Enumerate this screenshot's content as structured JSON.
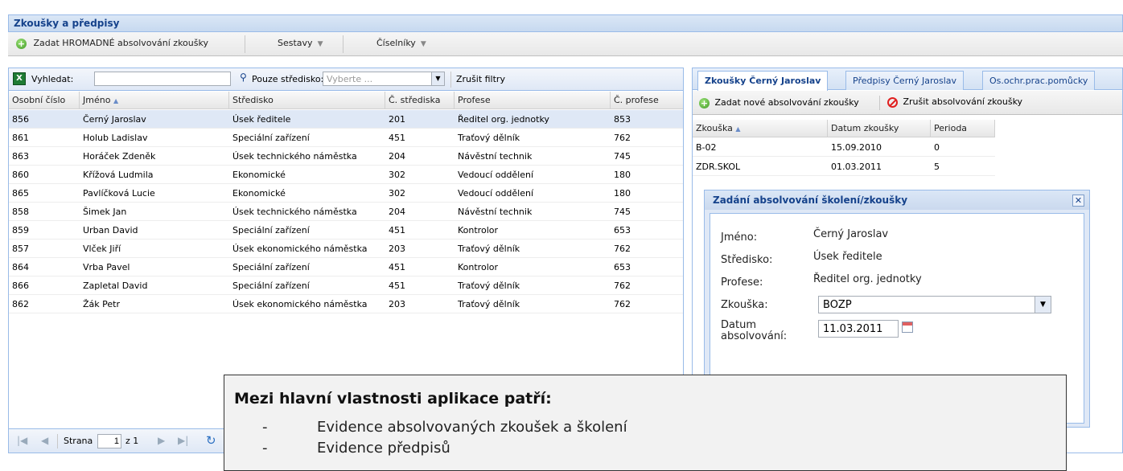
{
  "panel": {
    "title": "Zkoušky a předpisy"
  },
  "toolbar": {
    "bulk_label": "Zadat HROMADNÉ absolvování zkoušky",
    "reports_label": "Sestavy",
    "codes_label": "Číselníky"
  },
  "filter": {
    "search_label": "Vyhledat:",
    "search_value": "",
    "dept_only_label": "Pouze středisko:",
    "dept_placeholder": "Vyberte ...",
    "clear_label": "Zrušit filtry"
  },
  "grid": {
    "columns": [
      "Osobní číslo",
      "Jméno",
      "Středisko",
      "Č. střediska",
      "Profese",
      "Č. profese"
    ],
    "rows": [
      [
        "856",
        "Černý Jaroslav",
        "Úsek ředitele",
        "201",
        "Ředitel org. jednotky",
        "853"
      ],
      [
        "861",
        "Holub Ladislav",
        "Speciální zařízení",
        "451",
        "Traťový dělník",
        "762"
      ],
      [
        "863",
        "Horáček Zdeněk",
        "Úsek technického náměstka",
        "204",
        "Návěstní technik",
        "745"
      ],
      [
        "860",
        "Křížová Ludmila",
        "Ekonomické",
        "302",
        "Vedoucí oddělení",
        "180"
      ],
      [
        "865",
        "Pavlíčková Lucie",
        "Ekonomické",
        "302",
        "Vedoucí oddělení",
        "180"
      ],
      [
        "858",
        "Šimek Jan",
        "Úsek technického náměstka",
        "204",
        "Návěstní technik",
        "745"
      ],
      [
        "859",
        "Urban David",
        "Speciální zařízení",
        "451",
        "Kontrolor",
        "653"
      ],
      [
        "857",
        "Vlček Jiří",
        "Úsek ekonomického náměstka",
        "203",
        "Traťový dělník",
        "762"
      ],
      [
        "864",
        "Vrba Pavel",
        "Speciální zařízení",
        "451",
        "Kontrolor",
        "653"
      ],
      [
        "866",
        "Zapletal David",
        "Speciální zařízení",
        "451",
        "Traťový dělník",
        "762"
      ],
      [
        "862",
        "Žák Petr",
        "Úsek ekonomického náměstka",
        "203",
        "Traťový dělník",
        "762"
      ]
    ]
  },
  "pager": {
    "page_label": "Strana",
    "page_value": "1",
    "of_label": "z 1"
  },
  "tabs": [
    "Zkoušky Černý Jaroslav",
    "Předpisy Černý Jaroslav",
    "Os.ochr.prac.pomůcky"
  ],
  "right_toolbar": {
    "add_label": "Zadat nové absolvování zkoušky",
    "cancel_label": "Zrušit absolvování zkoušky"
  },
  "exams": {
    "columns": [
      "Zkouška",
      "Datum zkoušky",
      "Perioda"
    ],
    "rows": [
      [
        "B-02",
        "15.09.2010",
        "0"
      ],
      [
        "ZDR.SKOL",
        "01.03.2011",
        "5"
      ]
    ]
  },
  "dialog": {
    "title": "Zadání absolvování školení/zkoušky",
    "name_label": "Jméno:",
    "name_value": "Černý Jaroslav",
    "dept_label": "Středisko:",
    "dept_value": "Úsek ředitele",
    "prof_label": "Profese:",
    "prof_value": "Ředitel org. jednotky",
    "exam_label": "Zkouška:",
    "exam_value": "BOZP",
    "date_label_1": "Datum",
    "date_label_2": "absolvování:",
    "date_value": "11.03.2011"
  },
  "callout": {
    "title": "Mezi hlavní vlastnosti aplikace patří:",
    "items": [
      "Evidence absolvovaných zkoušek a školení",
      "Evidence předpisů"
    ]
  },
  "colors": {
    "accent": "#15428b",
    "border": "#99bbe8",
    "selected_row": "#dfe8f6"
  }
}
